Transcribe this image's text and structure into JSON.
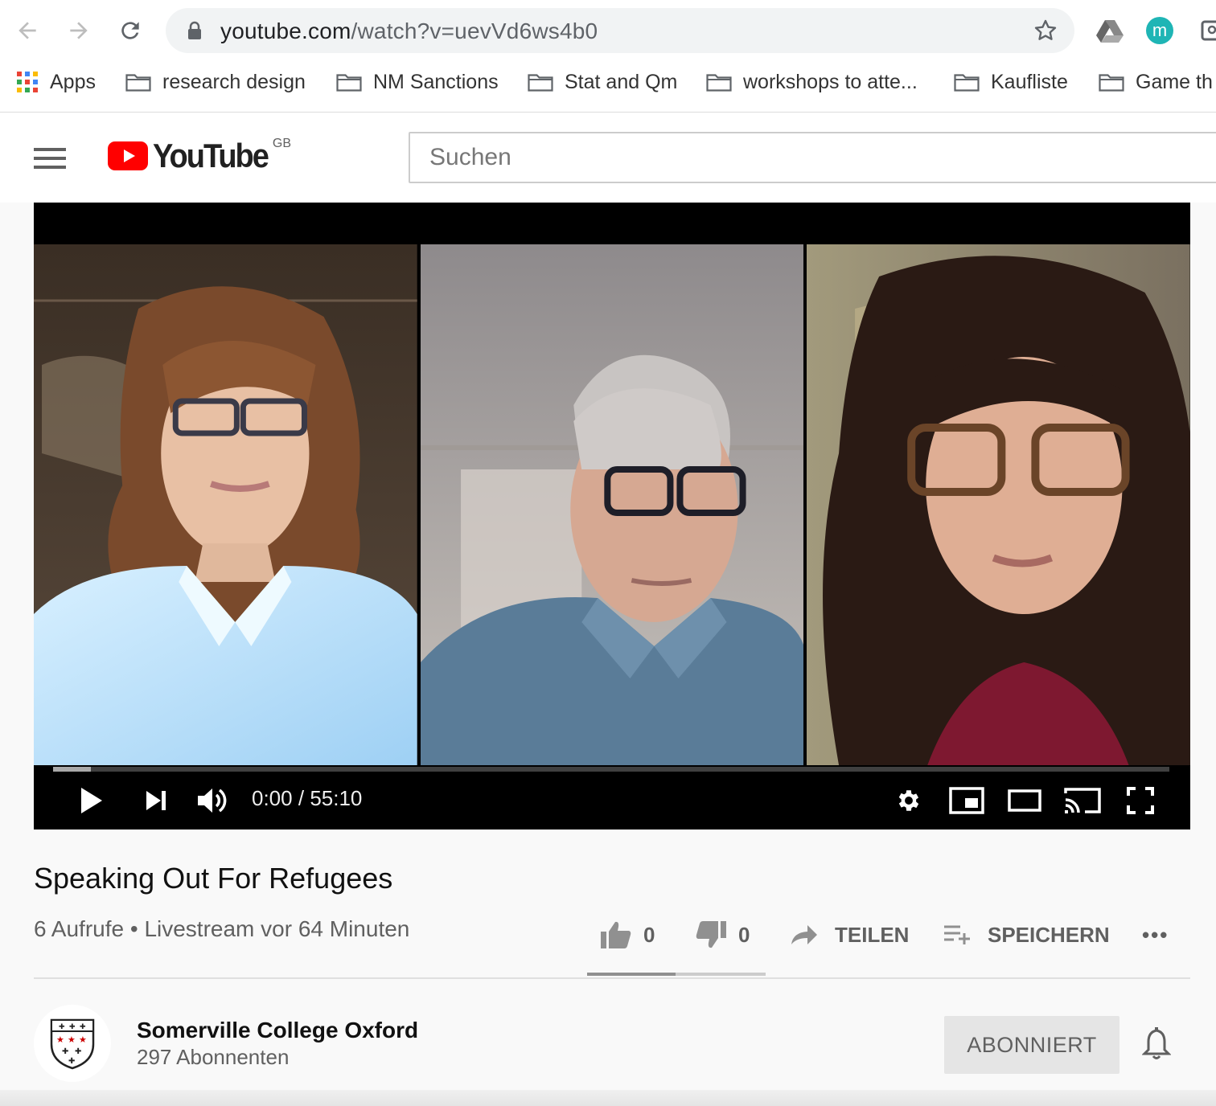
{
  "browser": {
    "url_host": "youtube.com",
    "url_path": "/watch?v=uevVd6ws4b0",
    "avatar_initial": "m",
    "bookmarks": [
      {
        "label": "Apps",
        "icon": "apps-grid-icon"
      },
      {
        "label": "research design",
        "icon": "folder-icon"
      },
      {
        "label": "NM Sanctions",
        "icon": "folder-icon"
      },
      {
        "label": "Stat and Qm",
        "icon": "folder-icon"
      },
      {
        "label": "workshops to atte...",
        "icon": "folder-icon"
      },
      {
        "label": "Kaufliste",
        "icon": "folder-icon"
      },
      {
        "label": "Game th",
        "icon": "folder-icon"
      }
    ]
  },
  "youtube": {
    "logo_text": "YouTube",
    "region": "GB",
    "search_placeholder": "Suchen",
    "brand_color": "#ff0000"
  },
  "player": {
    "time_current": "0:00",
    "time_separator": "/",
    "time_total": "55:10",
    "loaded_fraction": 0.034
  },
  "video": {
    "title": "Speaking Out For Refugees",
    "meta": "6 Aufrufe • Livestream vor 64 Minuten",
    "likes": "0",
    "dislikes": "0",
    "share_label": "TEILEN",
    "save_label": "SPEICHERN",
    "more_label": "•••"
  },
  "channel": {
    "name": "Somerville College Oxford",
    "subscribers": "297 Abonnenten",
    "subscribe_label": "ABONNIERT"
  }
}
